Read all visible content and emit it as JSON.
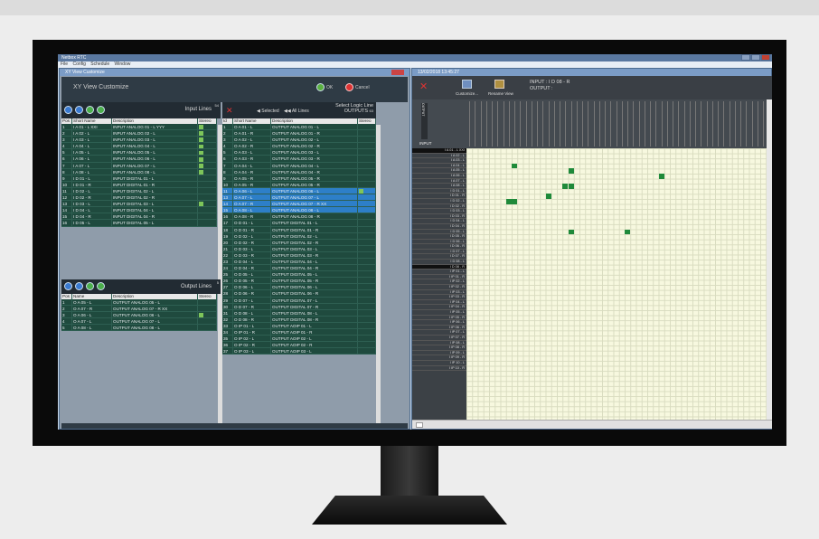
{
  "app": {
    "title": "Netbox RTC",
    "menu": [
      "File",
      "Config",
      "Schedule",
      "Window"
    ]
  },
  "dialog": {
    "window_title": "XY View Customize",
    "heading": "XY View Customize",
    "ok_label": "OK",
    "cancel_label": "Cancel",
    "input_lines_label": "Input Lines",
    "input_count": "54",
    "output_lines_label": "Output Lines",
    "output_count": "5",
    "input_columns": [
      "Pos",
      "Short Name",
      "Description",
      "Stereo"
    ],
    "input_rows": [
      [
        "1",
        "I A 01 - L XXI",
        "INPUT ANALOG 01 - L YYY",
        true
      ],
      [
        "2",
        "I A 02 - L",
        "INPUT ANALOG 02 - L",
        true
      ],
      [
        "3",
        "I A 03 - L",
        "INPUT ANALOG 03 - L",
        true
      ],
      [
        "4",
        "I A 04 - L",
        "INPUT ANALOG 04 - L",
        true
      ],
      [
        "5",
        "I A 05 - L",
        "INPUT ANALOG 05 - L",
        true
      ],
      [
        "6",
        "I A 06 - L",
        "INPUT ANALOG 06 - L",
        true
      ],
      [
        "7",
        "I A 07 - L",
        "INPUT ANALOG 07 - L",
        true
      ],
      [
        "8",
        "I A 08 - L",
        "INPUT ANALOG 08 - L",
        true
      ],
      [
        "9",
        "I D 01 - L",
        "INPUT DIGITAL 01 - L",
        false
      ],
      [
        "10",
        "I D 01 - R",
        "INPUT DIGITAL 01 - R",
        false
      ],
      [
        "11",
        "I D 02 - L",
        "INPUT DIGITAL 02 - L",
        false
      ],
      [
        "12",
        "I D 02 - R",
        "INPUT DIGITAL 02 - R",
        false
      ],
      [
        "13",
        "I D 03 - L",
        "INPUT DIGITAL 03 - L",
        true
      ],
      [
        "14",
        "I D 04 - L",
        "INPUT DIGITAL 04 - L",
        false
      ],
      [
        "15",
        "I D 04 - R",
        "INPUT DIGITAL 04 - R",
        false
      ],
      [
        "16",
        "I D 05 - L",
        "INPUT DIGITAL 05 - L",
        false
      ]
    ],
    "output_columns": [
      "Pos",
      "Name",
      "Description",
      "Stereo"
    ],
    "output_rows": [
      [
        "1",
        "O A 05 - L",
        "OUTPUT ANALOG 05 - L",
        false
      ],
      [
        "2",
        "O A 07 - R",
        "OUTPUT ANALOG 07 - R XX",
        false
      ],
      [
        "3",
        "O A 06 - L",
        "OUTPUT ANALOG 06 - L",
        true
      ],
      [
        "4",
        "O A 07 - L",
        "OUTPUT ANALOG 07 - L",
        false
      ],
      [
        "5",
        "O A 08 - L",
        "OUTPUT ANALOG 08 - L",
        false
      ]
    ],
    "selected_label": "Selected",
    "all_lines_label": "All Lines",
    "select_logic_line": "Select Logic Line",
    "outputs_label": "OUTPUTS",
    "outputs_count": "63",
    "logic_columns": [
      "Id",
      "Short Name",
      "Description",
      "Stereo"
    ],
    "logic_rows": [
      [
        "1",
        "O A 01 - L",
        "OUTPUT ANALOG 01 - L",
        false,
        false
      ],
      [
        "2",
        "O A 01 - R",
        "OUTPUT ANALOG 01 - R",
        false,
        false
      ],
      [
        "3",
        "O A 02 - L",
        "OUTPUT ANALOG 02 - L",
        false,
        false
      ],
      [
        "4",
        "O A 02 - R",
        "OUTPUT ANALOG 02 - R",
        false,
        false
      ],
      [
        "5",
        "O A 03 - L",
        "OUTPUT ANALOG 03 - L",
        false,
        false
      ],
      [
        "6",
        "O A 03 - R",
        "OUTPUT ANALOG 03 - R",
        false,
        false
      ],
      [
        "7",
        "O A 04 - L",
        "OUTPUT ANALOG 04 - L",
        false,
        false
      ],
      [
        "8",
        "O A 04 - R",
        "OUTPUT ANALOG 04 - R",
        false,
        false
      ],
      [
        "9",
        "O A 05 - R",
        "OUTPUT ANALOG 05 - R",
        false,
        false
      ],
      [
        "10",
        "O A 05 - R",
        "OUTPUT ANALOG 05 - R",
        false,
        false
      ],
      [
        "11",
        "O A 06 - L",
        "OUTPUT ANALOG 06 - L",
        true,
        true
      ],
      [
        "13",
        "O A 07 - L",
        "OUTPUT ANALOG 07 - L",
        false,
        true
      ],
      [
        "14",
        "O A 07 - R",
        "OUTPUT ANALOG 07 - R XX",
        false,
        true
      ],
      [
        "15",
        "O A 08 - L",
        "OUTPUT ANALOG 08 - L",
        false,
        true
      ],
      [
        "16",
        "O A 08 - R",
        "OUTPUT ANALOG 08 - R",
        false,
        false
      ],
      [
        "17",
        "O D 01 - L",
        "OUTPUT DIGITAL 01 - L",
        false,
        false
      ],
      [
        "18",
        "O D 01 - R",
        "OUTPUT DIGITAL 01 - R",
        false,
        false
      ],
      [
        "19",
        "O D 02 - L",
        "OUTPUT DIGITAL 02 - L",
        false,
        false
      ],
      [
        "20",
        "O D 02 - R",
        "OUTPUT DIGITAL 02 - R",
        false,
        false
      ],
      [
        "21",
        "O D 03 - L",
        "OUTPUT DIGITAL 03 - L",
        false,
        false
      ],
      [
        "22",
        "O D 03 - R",
        "OUTPUT DIGITAL 03 - R",
        false,
        false
      ],
      [
        "23",
        "O D 04 - L",
        "OUTPUT DIGITAL 04 - L",
        false,
        false
      ],
      [
        "24",
        "O D 04 - R",
        "OUTPUT DIGITAL 04 - R",
        false,
        false
      ],
      [
        "25",
        "O D 05 - L",
        "OUTPUT DIGITAL 05 - L",
        false,
        false
      ],
      [
        "26",
        "O D 05 - R",
        "OUTPUT DIGITAL 05 - R",
        false,
        false
      ],
      [
        "27",
        "O D 06 - L",
        "OUTPUT DIGITAL 06 - L",
        false,
        false
      ],
      [
        "28",
        "O D 06 - R",
        "OUTPUT DIGITAL 06 - R",
        false,
        false
      ],
      [
        "29",
        "O D 07 - L",
        "OUTPUT DIGITAL 07 - L",
        false,
        false
      ],
      [
        "30",
        "O D 07 - R",
        "OUTPUT DIGITAL 07 - R",
        false,
        false
      ],
      [
        "31",
        "O D 08 - L",
        "OUTPUT DIGITAL 08 - L",
        false,
        false
      ],
      [
        "32",
        "O D 08 - R",
        "OUTPUT DIGITAL 08 - R",
        false,
        false
      ],
      [
        "33",
        "O IP 01 - L",
        "OUTPUT AOIP 01 - L",
        false,
        false
      ],
      [
        "34",
        "O IP 01 - R",
        "OUTPUT AOIP 01 - R",
        false,
        false
      ],
      [
        "35",
        "O IP 02 - L",
        "OUTPUT AOIP 02 - L",
        false,
        false
      ],
      [
        "36",
        "O IP 02 - R",
        "OUTPUT AOIP 02 - R",
        false,
        false
      ],
      [
        "37",
        "O IP 03 - L",
        "OUTPUT AOIP 03 - L",
        false,
        false
      ]
    ]
  },
  "xy_view": {
    "window_title": "13/02/2018 13:45:27",
    "customize_label": "Customize...",
    "rename_label": "Rename View",
    "input_readout": "INPUT : I D 08 - R",
    "output_readout": "OUTPUT :",
    "input_axis_label": "INPUT",
    "output_axis_label": "OUTPUT",
    "row_labels": [
      "I A 01 - L XXI",
      "I A 02 - L",
      "I A 03 - L",
      "I A 04 - L",
      "I A 05 - L",
      "I A 06 - L",
      "I A 07 - L",
      "I A 08 - L",
      "I D 01 - L",
      "I D 01 - R",
      "I D 02 - L",
      "I D 02 - R",
      "I D 03 - L",
      "I D 03 - R",
      "I D 04 - L",
      "I D 04 - R",
      "I D 05 - L",
      "I D 05 - R",
      "I D 06 - L",
      "I D 06 - R",
      "I D 07 - L",
      "I D 07 - R",
      "I D 08 - L",
      "I D 08 - R",
      "I IP 01 - L",
      "I IP 01 - R",
      "I IP 02 - L",
      "I IP 02 - R",
      "I IP 03 - L",
      "I IP 03 - R",
      "I IP 04 - L",
      "I IP 04 - R",
      "I IP 05 - L",
      "I IP 05 - R",
      "I IP 06 - L",
      "I IP 06 - R",
      "I IP 07 - L",
      "I IP 07 - R",
      "I IP 08 - L",
      "I IP 08 - R",
      "I IP 09 - L",
      "I IP 09 - R",
      "I IP 10 - L",
      "I IP 10 - R"
    ],
    "highlight_rows": [
      0,
      23
    ],
    "crosspoints": [
      [
        3,
        8
      ],
      [
        4,
        18
      ],
      [
        5,
        34
      ],
      [
        7,
        17
      ],
      [
        7,
        18
      ],
      [
        9,
        14
      ],
      [
        10,
        7
      ],
      [
        10,
        8
      ],
      [
        16,
        18
      ],
      [
        16,
        28
      ]
    ]
  }
}
